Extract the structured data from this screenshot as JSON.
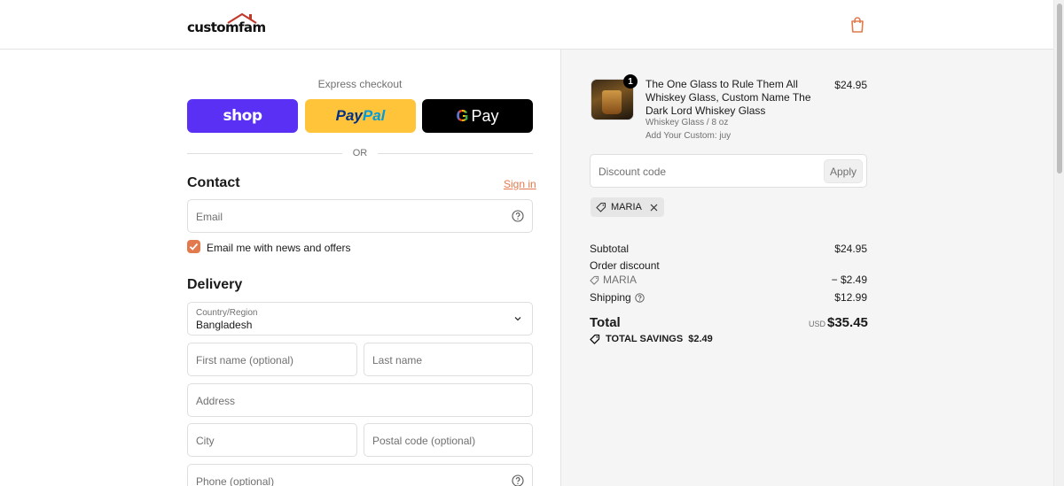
{
  "header": {
    "logo_text": "customfam"
  },
  "express": {
    "label": "Express checkout",
    "shop_label": "shop",
    "paypal_part1": "Pay",
    "paypal_part2": "Pal",
    "gpay_g": "G",
    "gpay_label": "Pay",
    "or_text": "OR"
  },
  "contact": {
    "title": "Contact",
    "signin_label": "Sign in",
    "email_placeholder": "Email",
    "newsletter_label": "Email me with news and offers",
    "newsletter_checked": true
  },
  "delivery": {
    "title": "Delivery",
    "country_label": "Country/Region",
    "country_value": "Bangladesh",
    "first_name_placeholder": "First name (optional)",
    "last_name_placeholder": "Last name",
    "address_placeholder": "Address",
    "city_placeholder": "City",
    "postal_placeholder": "Postal code (optional)",
    "phone_placeholder": "Phone (optional)"
  },
  "order": {
    "product": {
      "quantity": "1",
      "title": "The One Glass to Rule Them All Whiskey Glass, Custom Name The Dark Lord Whiskey Glass",
      "variant": "Whiskey Glass / 8 oz",
      "custom": "Add Your Custom: juy",
      "price": "$24.95"
    },
    "discount_placeholder": "Discount code",
    "apply_label": "Apply",
    "applied_code": "MARIA",
    "subtotal_label": "Subtotal",
    "subtotal_value": "$24.95",
    "order_discount_label": "Order discount",
    "discount_code_label": "MARIA",
    "discount_value": "− $2.49",
    "shipping_label": "Shipping",
    "shipping_value": "$12.99",
    "total_label": "Total",
    "total_currency": "USD",
    "total_value": "$35.45",
    "savings_label": "TOTAL SAVINGS",
    "savings_value": "$2.49"
  },
  "colors": {
    "accent": "#e27a4e",
    "shop": "#5a31f4",
    "paypal": "#ffc439",
    "gpay": "#000000"
  }
}
